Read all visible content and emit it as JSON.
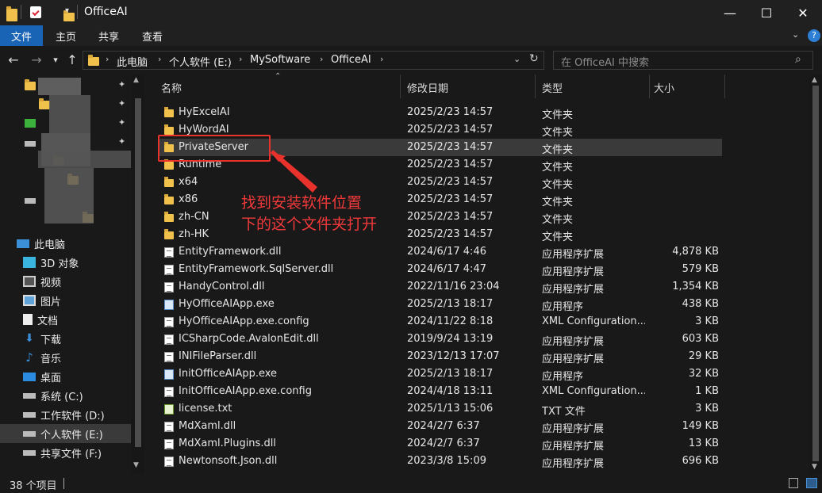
{
  "window": {
    "title": "OfficeAI",
    "buttons": {
      "minimize": "—",
      "maximize": "☐",
      "close": "✕"
    }
  },
  "ribbon": {
    "tabs": [
      "文件",
      "主页",
      "共享",
      "查看"
    ],
    "help": "?"
  },
  "address": {
    "breadcrumbs": [
      "此电脑",
      "个人软件 (E:)",
      "MySoftware",
      "OfficeAI"
    ],
    "search_placeholder": "在 OfficeAI 中搜索"
  },
  "sidebar": {
    "items": [
      {
        "label": "此电脑",
        "icon": "computer-icon"
      },
      {
        "label": "3D 对象",
        "icon": "cube-icon"
      },
      {
        "label": "视频",
        "icon": "video-icon"
      },
      {
        "label": "图片",
        "icon": "picture-icon"
      },
      {
        "label": "文档",
        "icon": "document-icon"
      },
      {
        "label": "下载",
        "icon": "download-icon"
      },
      {
        "label": "音乐",
        "icon": "music-icon"
      },
      {
        "label": "桌面",
        "icon": "desktop-icon"
      },
      {
        "label": "系统 (C:)",
        "icon": "drive-icon"
      },
      {
        "label": "工作软件 (D:)",
        "icon": "drive-icon"
      },
      {
        "label": "个人软件 (E:)",
        "icon": "drive-icon",
        "selected": true
      },
      {
        "label": "共享文件 (F:)",
        "icon": "drive-icon"
      }
    ]
  },
  "columns": {
    "name": "名称",
    "date": "修改日期",
    "type": "类型",
    "size": "大小"
  },
  "files": [
    {
      "name": "HyExcelAI",
      "date": "2025/2/23 14:57",
      "type": "文件夹",
      "size": "",
      "icon": "folder"
    },
    {
      "name": "HyWordAI",
      "date": "2025/2/23 14:57",
      "type": "文件夹",
      "size": "",
      "icon": "folder"
    },
    {
      "name": "PrivateServer",
      "date": "2025/2/23 14:57",
      "type": "文件夹",
      "size": "",
      "icon": "folder",
      "selected": true
    },
    {
      "name": "Runtime",
      "date": "2025/2/23 14:57",
      "type": "文件夹",
      "size": "",
      "icon": "folder"
    },
    {
      "name": "x64",
      "date": "2025/2/23 14:57",
      "type": "文件夹",
      "size": "",
      "icon": "folder"
    },
    {
      "name": "x86",
      "date": "2025/2/23 14:57",
      "type": "文件夹",
      "size": "",
      "icon": "folder"
    },
    {
      "name": "zh-CN",
      "date": "2025/2/23 14:57",
      "type": "文件夹",
      "size": "",
      "icon": "folder"
    },
    {
      "name": "zh-HK",
      "date": "2025/2/23 14:57",
      "type": "文件夹",
      "size": "",
      "icon": "folder"
    },
    {
      "name": "EntityFramework.dll",
      "date": "2024/6/17 4:46",
      "type": "应用程序扩展",
      "size": "4,878 KB",
      "icon": "doc"
    },
    {
      "name": "EntityFramework.SqlServer.dll",
      "date": "2024/6/17 4:47",
      "type": "应用程序扩展",
      "size": "579 KB",
      "icon": "doc"
    },
    {
      "name": "HandyControl.dll",
      "date": "2022/11/16 23:04",
      "type": "应用程序扩展",
      "size": "1,354 KB",
      "icon": "doc"
    },
    {
      "name": "HyOfficeAIApp.exe",
      "date": "2025/2/13 18:17",
      "type": "应用程序",
      "size": "438 KB",
      "icon": "exe"
    },
    {
      "name": "HyOfficeAIApp.exe.config",
      "date": "2024/11/22 8:18",
      "type": "XML Configuration...",
      "size": "3 KB",
      "icon": "doc"
    },
    {
      "name": "ICSharpCode.AvalonEdit.dll",
      "date": "2019/9/24 13:19",
      "type": "应用程序扩展",
      "size": "603 KB",
      "icon": "doc"
    },
    {
      "name": "INIFileParser.dll",
      "date": "2023/12/13 17:07",
      "type": "应用程序扩展",
      "size": "29 KB",
      "icon": "doc"
    },
    {
      "name": "InitOfficeAIApp.exe",
      "date": "2025/2/13 18:17",
      "type": "应用程序",
      "size": "32 KB",
      "icon": "exe"
    },
    {
      "name": "InitOfficeAIApp.exe.config",
      "date": "2024/4/18 13:11",
      "type": "XML Configuration...",
      "size": "1 KB",
      "icon": "doc"
    },
    {
      "name": "license.txt",
      "date": "2025/1/13 15:06",
      "type": "TXT 文件",
      "size": "3 KB",
      "icon": "txt"
    },
    {
      "name": "MdXaml.dll",
      "date": "2024/2/7 6:37",
      "type": "应用程序扩展",
      "size": "149 KB",
      "icon": "doc"
    },
    {
      "name": "MdXaml.Plugins.dll",
      "date": "2024/2/7 6:37",
      "type": "应用程序扩展",
      "size": "13 KB",
      "icon": "doc"
    },
    {
      "name": "Newtonsoft.Json.dll",
      "date": "2023/3/8 15:09",
      "type": "应用程序扩展",
      "size": "696 KB",
      "icon": "doc"
    }
  ],
  "status": {
    "item_count": "38 个项目"
  },
  "annotation": {
    "line1": "找到安装软件位置",
    "line2": "下的这个文件夹打开",
    "color": "#e8322b"
  }
}
